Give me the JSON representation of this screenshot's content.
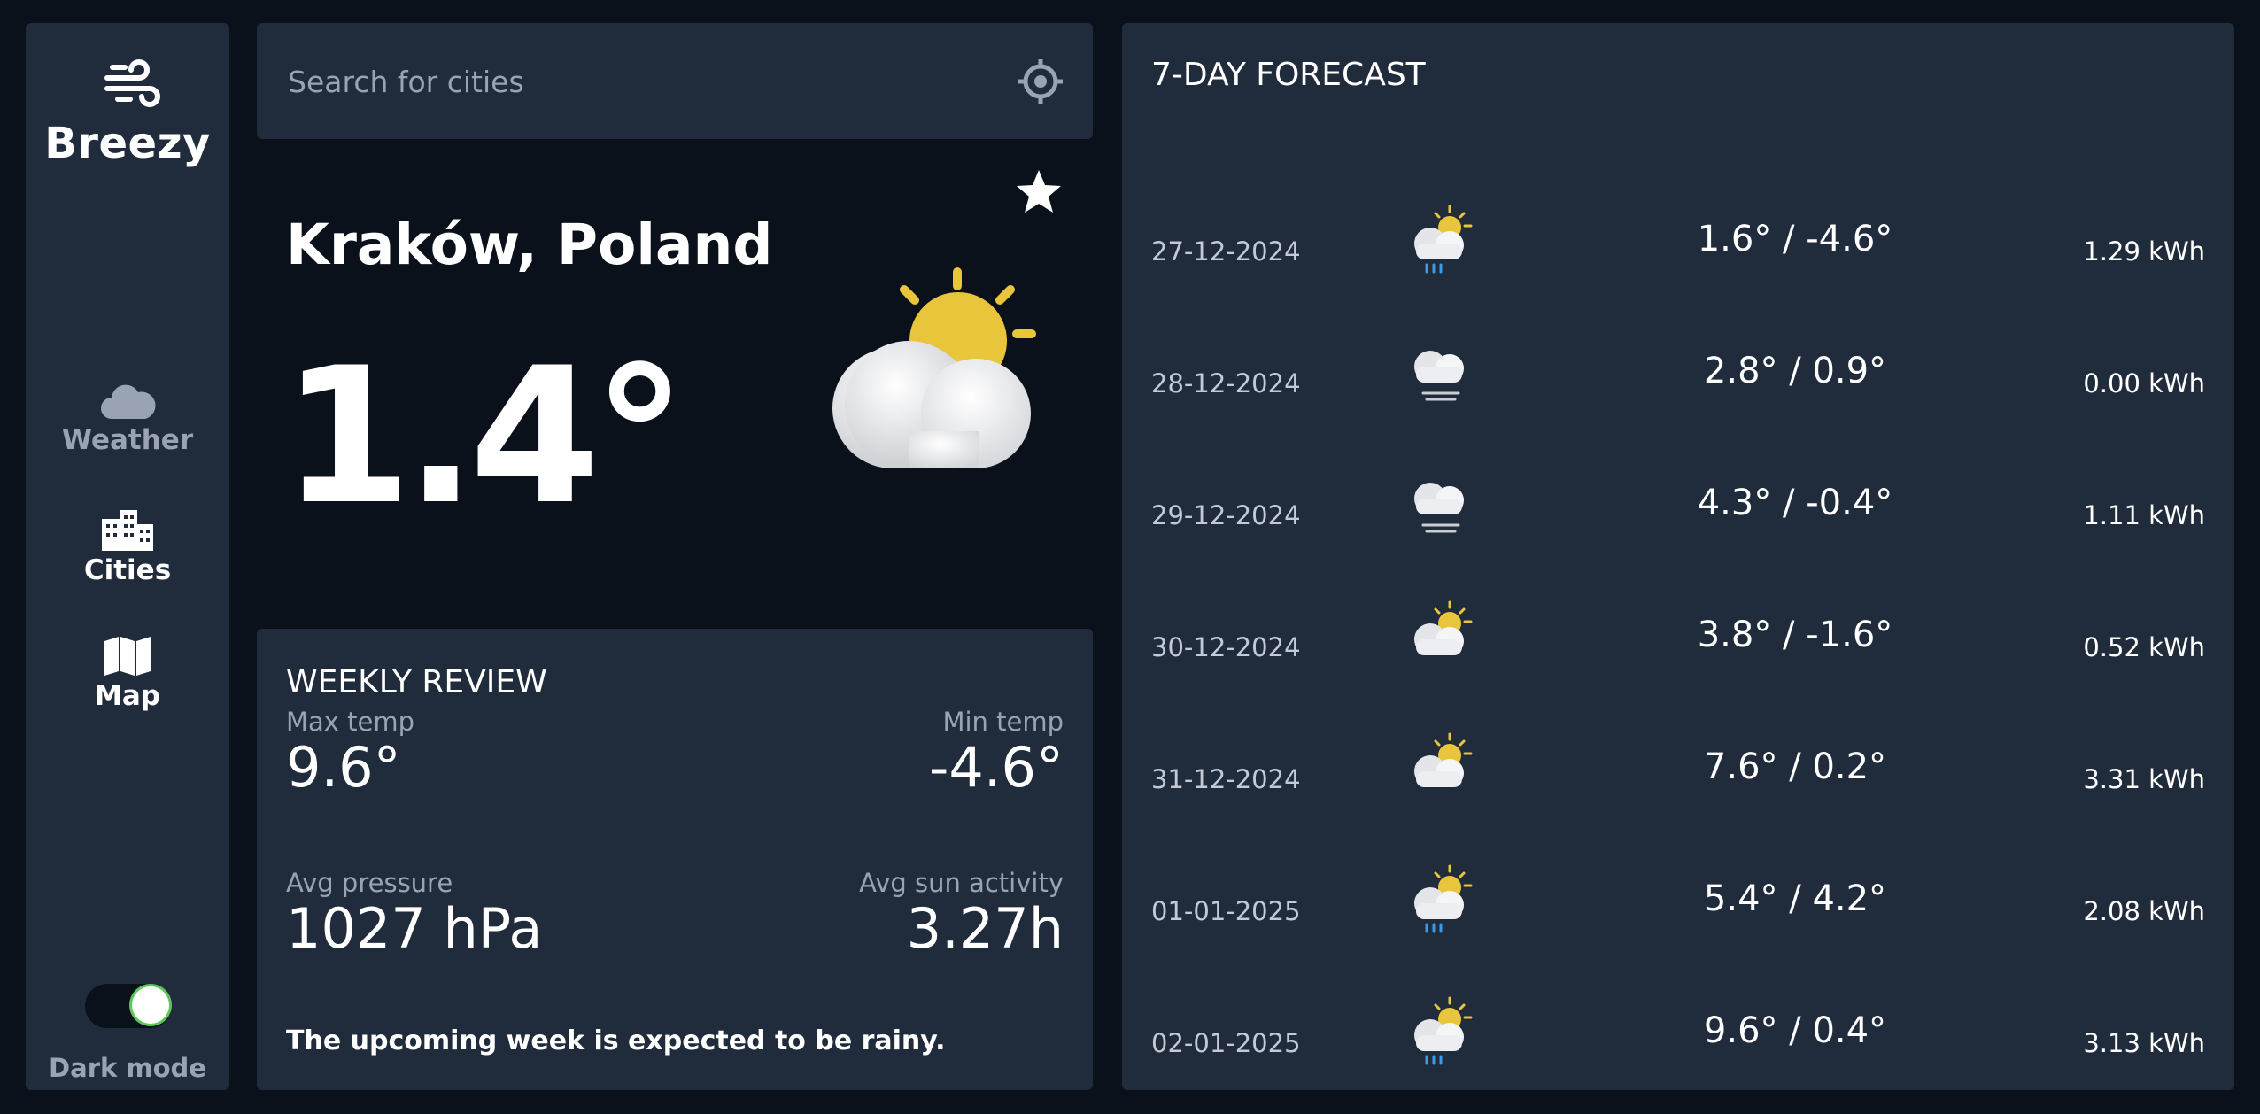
{
  "app": {
    "name": "Breezy"
  },
  "sidebar": {
    "nav": [
      {
        "label": "Weather",
        "icon": "cloud-icon",
        "active": false
      },
      {
        "label": "Cities",
        "icon": "buildings-icon",
        "active": true
      },
      {
        "label": "Map",
        "icon": "map-icon",
        "active": true
      }
    ],
    "dark_mode": {
      "label": "Dark mode",
      "enabled": true
    }
  },
  "search": {
    "placeholder": "Search for cities"
  },
  "current": {
    "city": "Kraków, Poland",
    "temperature": "1.4°",
    "condition_icon": "partly-cloudy-icon",
    "favorite_icon": "star-icon"
  },
  "weekly_review": {
    "title": "WEEKLY REVIEW",
    "max_temp_label": "Max temp",
    "max_temp": "9.6°",
    "min_temp_label": "Min temp",
    "min_temp": "-4.6°",
    "avg_pressure_label": "Avg pressure",
    "avg_pressure": "1027 hPa",
    "avg_sun_label": "Avg sun activity",
    "avg_sun": "3.27h",
    "summary": "The upcoming week is expected to be rainy."
  },
  "forecast": {
    "title": "7-DAY FORECAST",
    "days": [
      {
        "date": "27-12-2024",
        "icon": "sun-cloud-rain-icon",
        "temps": "1.6° / -4.6°",
        "energy": "1.29 kWh"
      },
      {
        "date": "28-12-2024",
        "icon": "cloud-fog-icon",
        "temps": "2.8° / 0.9°",
        "energy": "0.00 kWh"
      },
      {
        "date": "29-12-2024",
        "icon": "cloud-fog-icon",
        "temps": "4.3° / -0.4°",
        "energy": "1.11 kWh"
      },
      {
        "date": "30-12-2024",
        "icon": "sun-cloud-icon",
        "temps": "3.8° / -1.6°",
        "energy": "0.52 kWh"
      },
      {
        "date": "31-12-2024",
        "icon": "sun-cloud-icon",
        "temps": "7.6° / 0.2°",
        "energy": "3.31 kWh"
      },
      {
        "date": "01-01-2025",
        "icon": "sun-cloud-rain-icon",
        "temps": "5.4° / 4.2°",
        "energy": "2.08 kWh"
      },
      {
        "date": "02-01-2025",
        "icon": "sun-cloud-rain-icon",
        "temps": "9.6° / 0.4°",
        "energy": "3.13 kWh"
      }
    ]
  },
  "colors": {
    "background": "#0b111b",
    "panel": "#202b3b",
    "muted_text": "#9aa3b2",
    "sun": "#e9c53c",
    "rain": "#3b9be6",
    "toggle_ring": "#5bc85b"
  }
}
